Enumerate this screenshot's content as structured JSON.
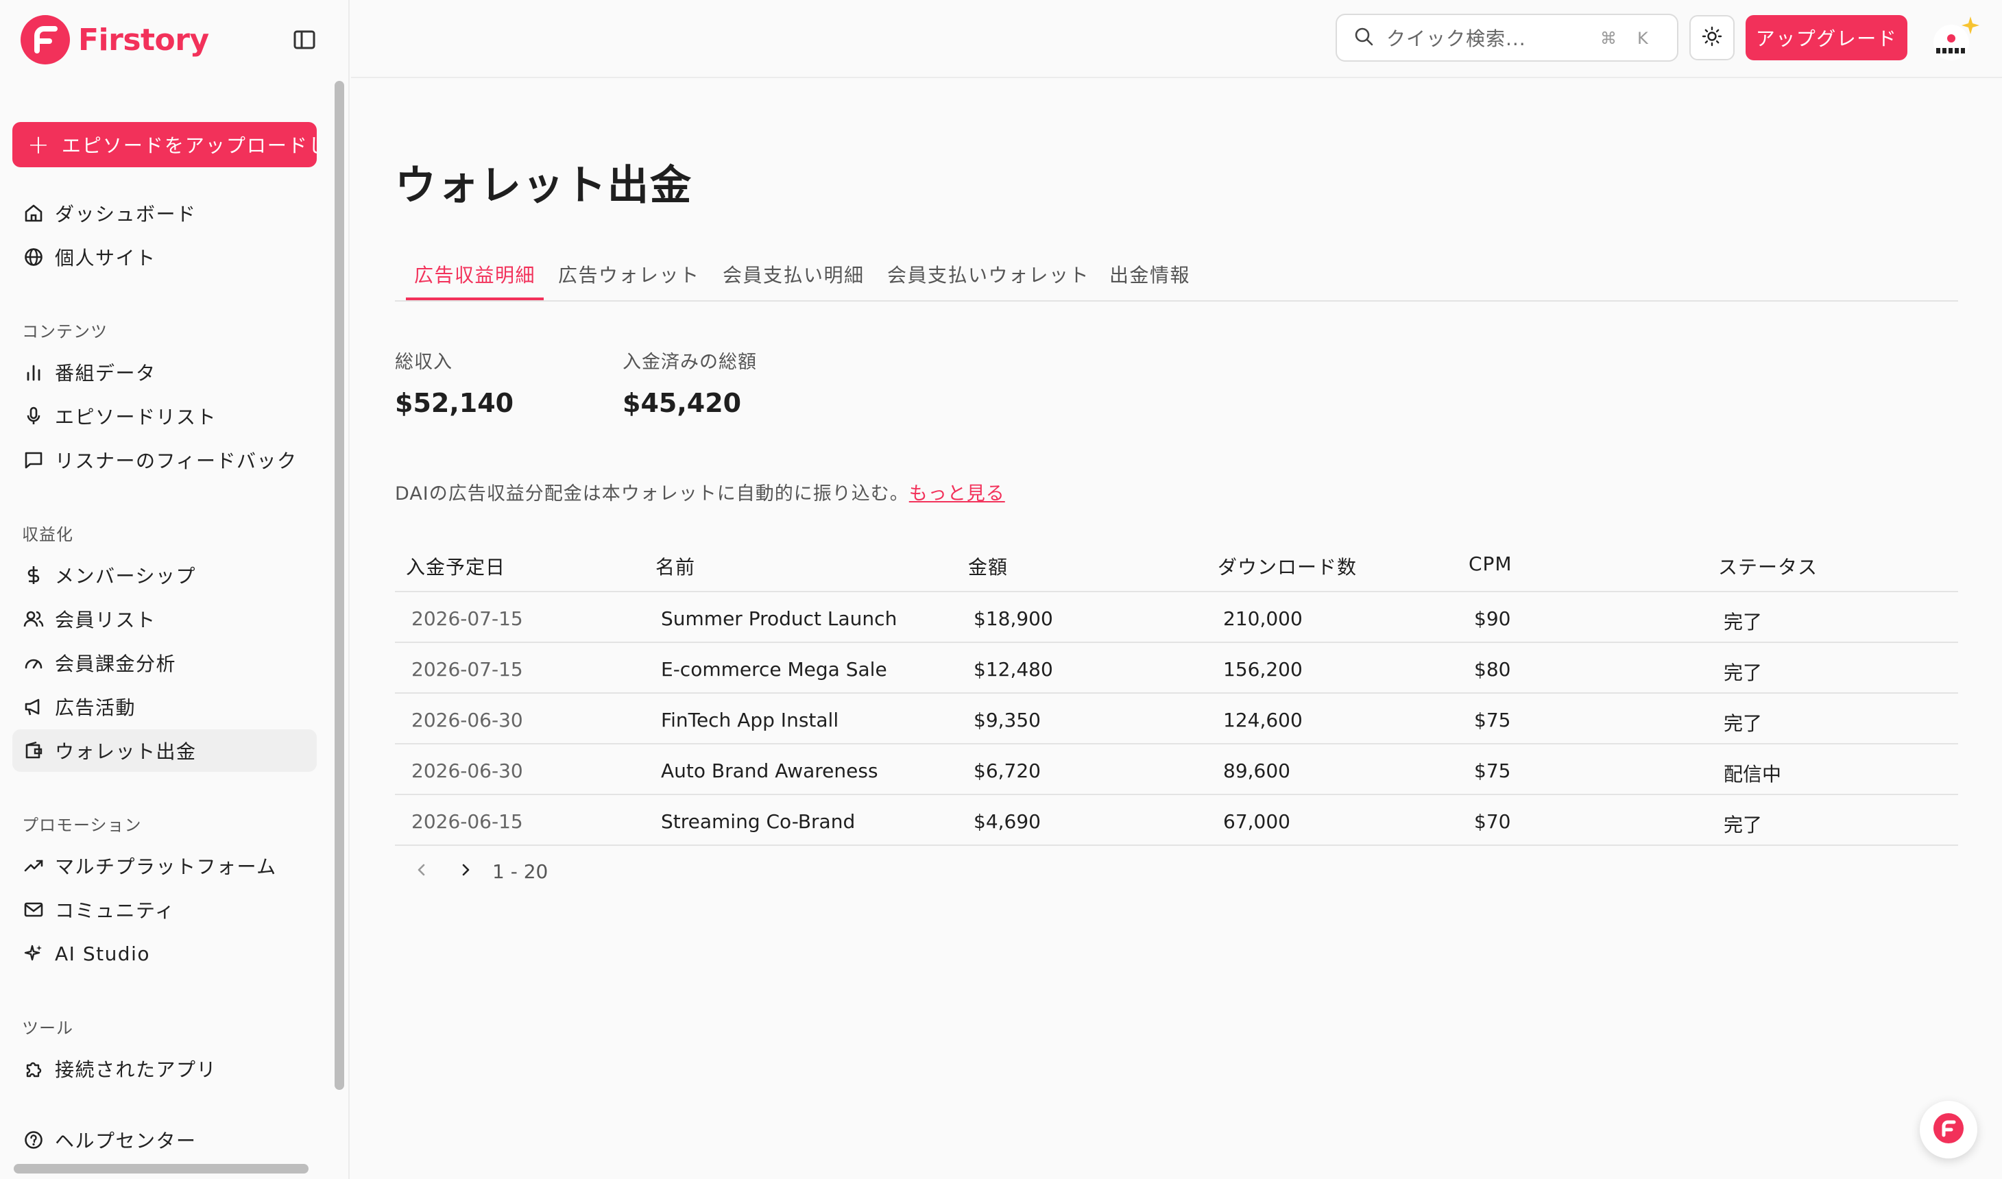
{
  "brand": {
    "name": "Firstory"
  },
  "sidebar": {
    "upload_label": "エピソードをアップロードしま",
    "top_items": [
      {
        "label": "ダッシュボード",
        "icon": "home-icon"
      },
      {
        "label": "個人サイト",
        "icon": "globe-icon"
      }
    ],
    "sections": [
      {
        "title": "コンテンツ",
        "items": [
          {
            "label": "番組データ",
            "icon": "bar-chart-icon"
          },
          {
            "label": "エピソードリスト",
            "icon": "microphone-icon"
          },
          {
            "label": "リスナーのフィードバック",
            "icon": "message-square-icon"
          }
        ]
      },
      {
        "title": "収益化",
        "items": [
          {
            "label": "メンバーシップ",
            "icon": "dollar-icon"
          },
          {
            "label": "会員リスト",
            "icon": "users-icon"
          },
          {
            "label": "会員課金分析",
            "icon": "gauge-icon"
          },
          {
            "label": "広告活動",
            "icon": "megaphone-icon"
          },
          {
            "label": "ウォレット出金",
            "icon": "wallet-icon",
            "active": true
          }
        ]
      },
      {
        "title": "プロモーション",
        "items": [
          {
            "label": "マルチプラットフォーム",
            "icon": "trending-up-icon"
          },
          {
            "label": "コミュニティ",
            "icon": "mail-icon"
          },
          {
            "label": "AI Studio",
            "icon": "sparkles-icon"
          }
        ]
      },
      {
        "title": "ツール",
        "items": [
          {
            "label": "接続されたアプリ",
            "icon": "puzzle-icon"
          }
        ]
      }
    ],
    "help_label": "ヘルプセンター"
  },
  "header": {
    "search_placeholder": "クイック検索...",
    "shortcut_cmd": "⌘",
    "shortcut_key": "K",
    "upgrade_label": "アップグレード"
  },
  "main": {
    "title": "ウォレット出金",
    "tabs": [
      {
        "label": "広告収益明細",
        "active": true
      },
      {
        "label": "広告ウォレット"
      },
      {
        "label": "会員支払い明細"
      },
      {
        "label": "会員支払いウォレット"
      },
      {
        "label": "出金情報"
      }
    ],
    "stats": [
      {
        "label": "総収入",
        "value": "$52,140"
      },
      {
        "label": "入金済みの総額",
        "value": "$45,420"
      }
    ],
    "note": "DAIの広告収益分配金は本ウォレットに自動的に振り込む。",
    "note_link": "もっと見る",
    "table": {
      "columns": [
        "入金予定日",
        "名前",
        "金額",
        "ダウンロード数",
        "CPM",
        "ステータス"
      ],
      "rows": [
        [
          "2026-07-15",
          "Summer Product Launch",
          "$18,900",
          "210,000",
          "$90",
          "完了"
        ],
        [
          "2026-07-15",
          "E-commerce Mega Sale",
          "$12,480",
          "156,200",
          "$80",
          "完了"
        ],
        [
          "2026-06-30",
          "FinTech App Install",
          "$9,350",
          "124,600",
          "$75",
          "完了"
        ],
        [
          "2026-06-30",
          "Auto Brand Awareness",
          "$6,720",
          "89,600",
          "$75",
          "配信中"
        ],
        [
          "2026-06-15",
          "Streaming Co-Brand",
          "$4,690",
          "67,000",
          "$70",
          "完了"
        ]
      ]
    },
    "pagination": "1 - 20"
  },
  "colors": {
    "accent": "#f2315a",
    "text": "#1f1f1f",
    "muted": "#555555",
    "border": "#e3e3e3"
  }
}
